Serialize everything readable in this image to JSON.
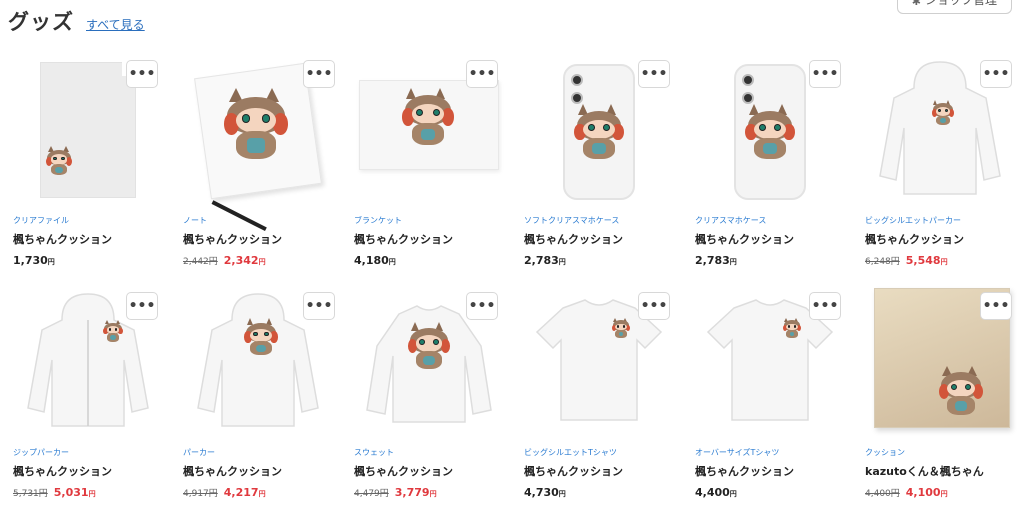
{
  "header": {
    "title": "グッズ",
    "see_all": "すべて見る"
  },
  "shop_button": {
    "label": "ショップ管理",
    "icon": "gear-icon"
  },
  "more_label": "•••",
  "yen": "円",
  "products": [
    {
      "category": "クリアファイル",
      "name": "楓ちゃんクッション",
      "price": "1,730",
      "old_price": "",
      "sale_price": "",
      "kind": "clearfile"
    },
    {
      "category": "ノート",
      "name": "楓ちゃんクッション",
      "price": "",
      "old_price": "2,442",
      "sale_price": "2,342",
      "kind": "note"
    },
    {
      "category": "ブランケット",
      "name": "楓ちゃんクッション",
      "price": "4,180",
      "old_price": "",
      "sale_price": "",
      "kind": "blanket"
    },
    {
      "category": "ソフトクリアスマホケース",
      "name": "楓ちゃんクッション",
      "price": "2,783",
      "old_price": "",
      "sale_price": "",
      "kind": "phone"
    },
    {
      "category": "クリアスマホケース",
      "name": "楓ちゃんクッション",
      "price": "2,783",
      "old_price": "",
      "sale_price": "",
      "kind": "phone"
    },
    {
      "category": "ビッグシルエットパーカー",
      "name": "楓ちゃんクッション",
      "price": "",
      "old_price": "6,248",
      "sale_price": "5,548",
      "kind": "hoodie"
    },
    {
      "category": "ジップパーカー",
      "name": "楓ちゃんクッション",
      "price": "",
      "old_price": "5,731",
      "sale_price": "5,031",
      "kind": "zip"
    },
    {
      "category": "パーカー",
      "name": "楓ちゃんクッション",
      "price": "",
      "old_price": "4,917",
      "sale_price": "4,217",
      "kind": "hoodie2"
    },
    {
      "category": "スウェット",
      "name": "楓ちゃんクッション",
      "price": "",
      "old_price": "4,479",
      "sale_price": "3,779",
      "kind": "sweat"
    },
    {
      "category": "ビッグシルエットTシャツ",
      "name": "楓ちゃんクッション",
      "price": "4,730",
      "old_price": "",
      "sale_price": "",
      "kind": "tshirt"
    },
    {
      "category": "オーバーサイズTシャツ",
      "name": "楓ちゃんクッション",
      "price": "4,400",
      "old_price": "",
      "sale_price": "",
      "kind": "tshirt"
    },
    {
      "category": "クッション",
      "name": "kazutoくん＆楓ちゃん",
      "price": "",
      "old_price": "4,400",
      "sale_price": "4,100",
      "kind": "cushion"
    }
  ]
}
